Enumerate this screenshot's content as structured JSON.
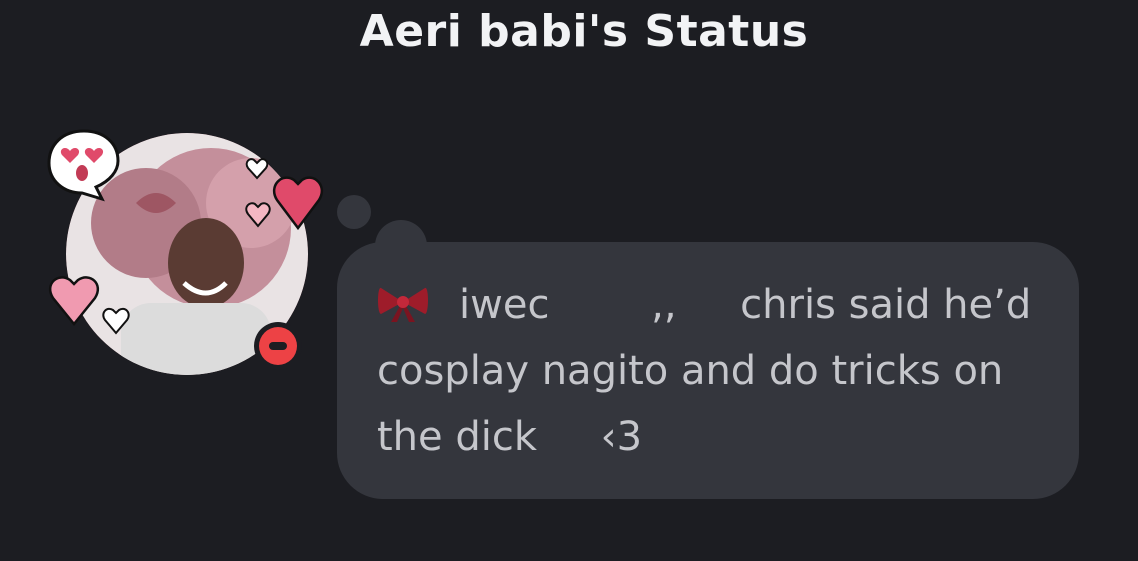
{
  "header": {
    "title": "Aeri babi's Status"
  },
  "avatar": {
    "icon": "avatar-image",
    "status": "do-not-disturb",
    "status_color": "#ed4245"
  },
  "status": {
    "emoji_icon": "red-bow-icon",
    "line1": "iwec        ,,     chris said he’d",
    "line2": "cosplay nagito and do tricks on",
    "line3": "the dick     ‹3"
  },
  "colors": {
    "background": "#1c1d22",
    "bubble": "#34363d",
    "title_text": "#f2f3f5",
    "body_text": "#c5c6cb"
  }
}
